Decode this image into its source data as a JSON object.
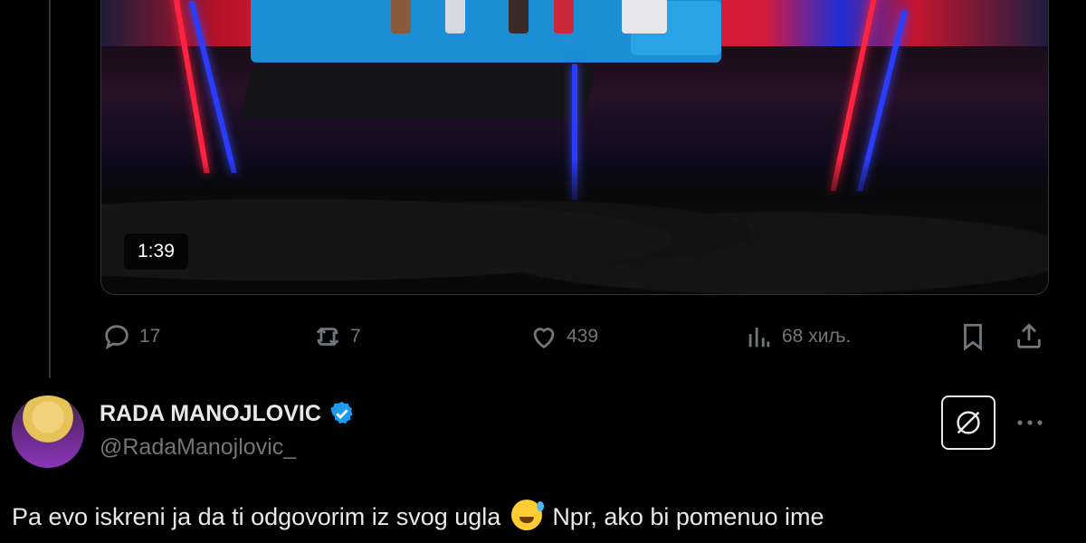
{
  "video": {
    "timestamp": "1:39"
  },
  "actions": {
    "replies": "17",
    "reposts": "7",
    "likes": "439",
    "views": "68 хиљ."
  },
  "reply": {
    "display_name": "RADA MANOJLOVIC",
    "handle": "@RadaManojlovic_",
    "text_before_emoji": "Pa evo iskreni ja da ti odgovorim iz svog ugla",
    "text_after_emoji": "Npr, ako bi pomenuo ime"
  },
  "colors": {
    "background": "#000000",
    "muted": "#71767b",
    "text": "#e7e9ea",
    "verified": "#1d9bf0"
  },
  "icons": [
    "reply-icon",
    "repost-icon",
    "like-icon",
    "views-icon",
    "bookmark-icon",
    "share-icon",
    "verified-icon",
    "grok-icon",
    "more-icon",
    "emoji-sweat-smile"
  ]
}
